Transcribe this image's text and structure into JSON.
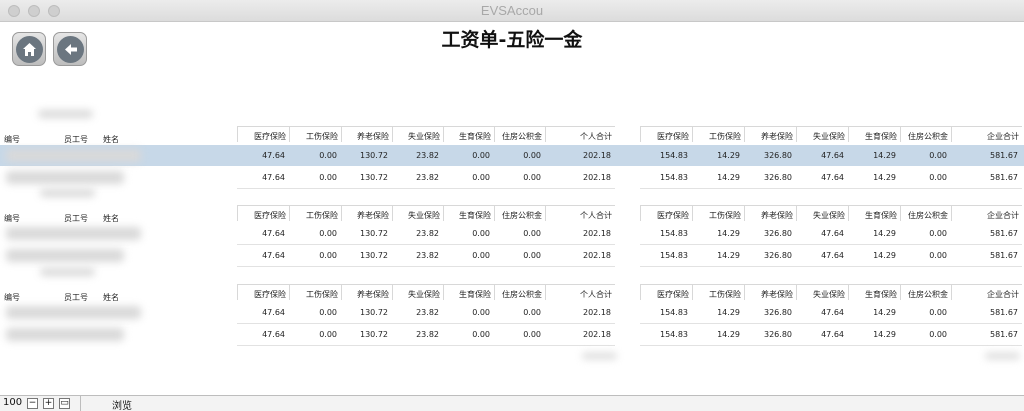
{
  "window": {
    "title": "EVSAccou"
  },
  "page": {
    "title": "工资单-五险一金"
  },
  "nav": {
    "home_icon": "home-icon",
    "back_icon": "back-arrow-icon"
  },
  "list_headers": {
    "number": "编号",
    "employee_id": "员工号",
    "name": "姓名"
  },
  "personal_headers": [
    "医疗保险",
    "工伤保险",
    "养老保险",
    "失业保险",
    "生育保险",
    "住房公积金",
    "个人合计"
  ],
  "company_headers": [
    "医疗保险",
    "工伤保险",
    "养老保险",
    "失业保险",
    "生育保险",
    "住房公积金",
    "企业合计"
  ],
  "row_values": {
    "personal": [
      "47.64",
      "0.00",
      "130.72",
      "23.82",
      "0.00",
      "0.00",
      "202.18"
    ],
    "company": [
      "154.83",
      "14.29",
      "326.80",
      "47.64",
      "14.29",
      "0.00",
      "581.67"
    ]
  },
  "bottombar": {
    "zoom": "100",
    "mode": "浏览"
  },
  "colors": {
    "selected_row": "#c7d8e8"
  }
}
